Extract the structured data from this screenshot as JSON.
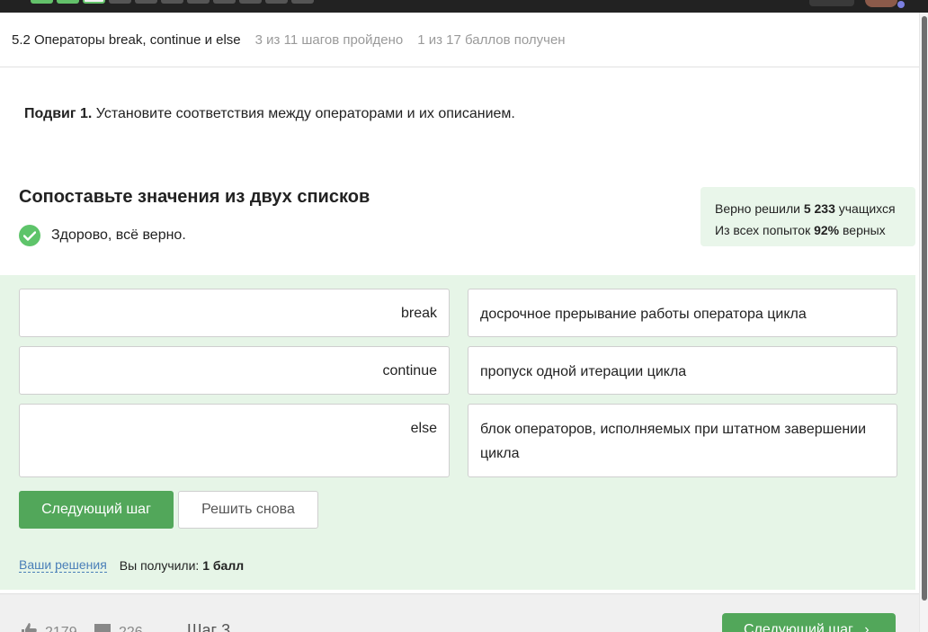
{
  "steps": [
    "done",
    "done",
    "current",
    "todo",
    "todo",
    "todo",
    "todo",
    "todo",
    "todo",
    "todo",
    "todo"
  ],
  "header": {
    "lesson_title": "5.2 Операторы break, continue и else",
    "steps_progress": "3 из 11 шагов пройдено",
    "points": "1 из 17 баллов  получен"
  },
  "task": {
    "prefix": "Подвиг 1.",
    "text": " Установите соответствия между операторами и их описанием."
  },
  "question": {
    "title": "Сопоставьте значения из двух списков",
    "status_text": "Здорово, всё верно."
  },
  "stats": {
    "line1_prefix": "Верно решили ",
    "solved_count": "5 233",
    "line1_suffix": " учащихся",
    "line2_prefix": "Из всех попыток ",
    "percent": "92%",
    "line2_suffix": " верных"
  },
  "matching": {
    "left": [
      "break",
      "continue",
      "else"
    ],
    "right": [
      "досрочное прерывание работы оператора цикла",
      "пропуск одной итерации цикла",
      "блок операторов, исполняемых при штатном завершении цикла"
    ]
  },
  "buttons": {
    "next_step": "Следующий шаг",
    "retry": "Решить снова"
  },
  "solutions": {
    "link": "Ваши решения",
    "got_prefix": "Вы получили: ",
    "got_value": "1 балл"
  },
  "footer": {
    "likes": "2179",
    "comments": "226",
    "step_label": "Шаг 3",
    "next_step": "Следующий шаг"
  },
  "colors": {
    "accent_green": "#52a75a",
    "quiz_bg": "#e6f5e7",
    "stats_bg": "#e9f6ea"
  }
}
